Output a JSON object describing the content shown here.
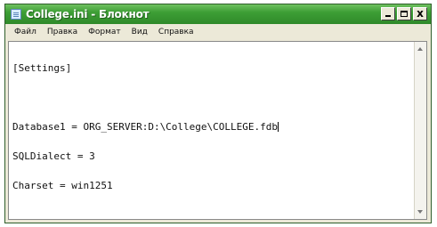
{
  "window": {
    "title": "College.ini - Блокнот",
    "controls": {
      "close_label": "x"
    },
    "title_bar_color": "#3d9e35"
  },
  "menu": [
    {
      "label": "Файл"
    },
    {
      "label": "Правка"
    },
    {
      "label": "Формат"
    },
    {
      "label": "Вид"
    },
    {
      "label": "Справка"
    }
  ],
  "editor": {
    "lines": [
      "[Settings]",
      "",
      "Database1 = ORG_SERVER:D:\\College\\COLLEGE.fdb",
      "SQLDialect = 3",
      "Charset = win1251"
    ]
  },
  "icons": {
    "app": "notepad-icon",
    "minimize": "minimize-icon",
    "maximize": "maximize-icon",
    "close": "close-icon",
    "scroll_up": "arrow-up-icon",
    "scroll_down": "arrow-down-icon"
  }
}
